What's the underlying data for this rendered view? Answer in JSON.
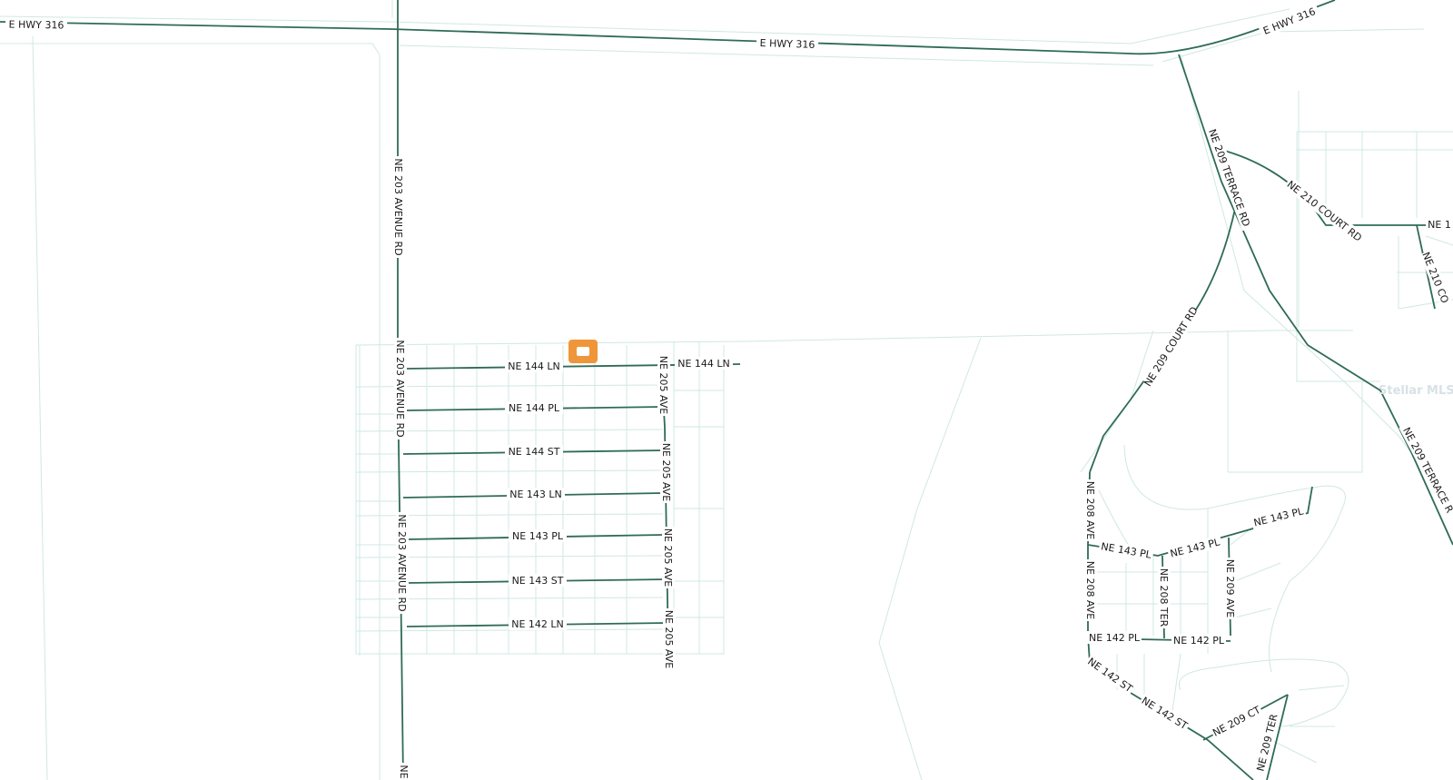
{
  "map": {
    "subject_marker": {
      "color": "#f0963a",
      "icon": "parcel-highlight-icon"
    },
    "road_color": "#2f6b57",
    "parcel_color": "#cfe8e4",
    "labels": {
      "hwy_left": "E HWY 316",
      "hwy_mid": "E HWY 316",
      "hwy_right": "E HWY 316",
      "av203_a": "NE 203 AVENUE RD",
      "av203_b": "NE 203 AVENUE RD",
      "av203_c": "NE 203 AVENUE RD",
      "av203_d": "NE",
      "ln144_a": "NE 144 LN",
      "ln144_b": "NE 144 LN",
      "pl144": "NE 144 PL",
      "st144": "NE 144 ST",
      "ln143": "NE 143 LN",
      "pl143": "NE 143 PL",
      "st143": "NE 143 ST",
      "ln142": "NE 142 LN",
      "av205_a": "NE 205 AVE",
      "av205_b": "NE 205 AVE",
      "av205_c": "NE 205 AVE",
      "av205_d": "NE 205 AVE",
      "ter209_a": "NE 209 TERRACE RD",
      "ter209_b": "NE 209 TERRACE R",
      "ct210": "NE 210 COURT RD",
      "ne14_partial": "NE 1",
      "ct210_b": "NE 210 CO",
      "ct209": "NE 209 COURT RD",
      "av208_a": "NE 208 AVE",
      "av208_b": "NE 208 AVE",
      "pl143_e1": "NE 143 PL",
      "pl143_e2": "NE 143 PL",
      "pl143_e3": "NE 143 PL",
      "ter208": "NE 208 TER",
      "av209": "NE 209 AVE",
      "pl142_a": "NE 142 PL",
      "pl142_b": "NE 142 PL",
      "st142_a": "NE 142 ST",
      "st142_b": "NE 142 ST",
      "ct209_s": "NE 209 CT",
      "ter209_s": "NE 209 TER",
      "watermark": "Stellar MLS"
    }
  }
}
